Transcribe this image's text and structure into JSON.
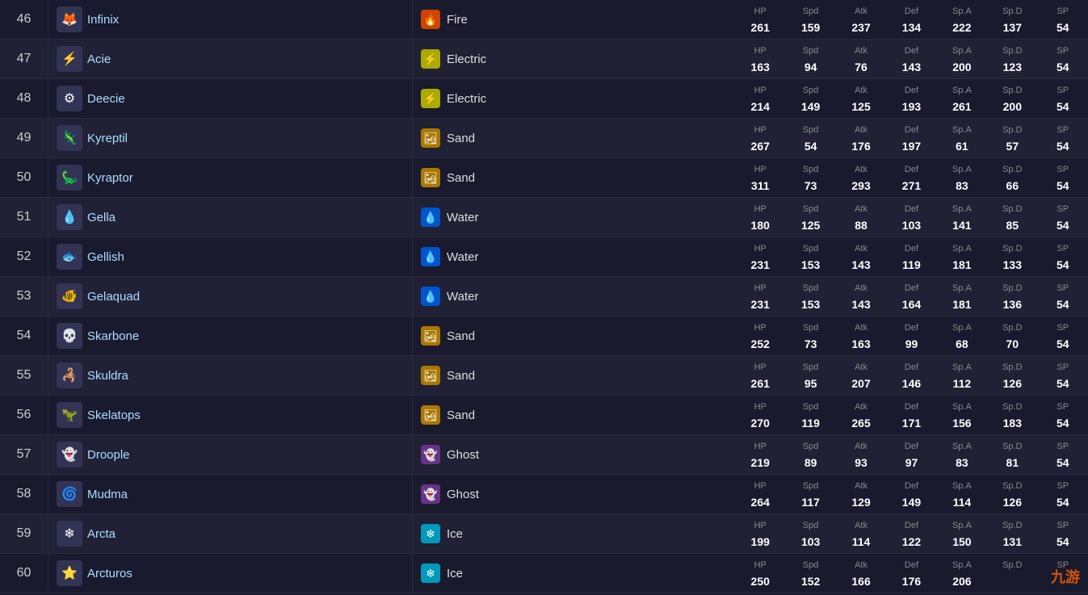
{
  "colors": {
    "accent": "#aaddff",
    "fire": "#cc4400",
    "electric": "#aaaa00",
    "sand": "#aa7700",
    "water": "#0055cc",
    "ghost": "#663388",
    "ice": "#0099bb"
  },
  "stat_labels": [
    "HP",
    "Spd",
    "Atk",
    "Def",
    "Sp.A",
    "Sp.D",
    "SP"
  ],
  "rows": [
    {
      "num": "46",
      "name": "Infinix",
      "icon": "🦊",
      "type": "Fire",
      "type_class": "type-fire",
      "type_icon": "🔥",
      "stats": [
        261,
        159,
        237,
        134,
        222,
        137,
        54
      ]
    },
    {
      "num": "47",
      "name": "Acie",
      "icon": "⚡",
      "type": "Electric",
      "type_class": "type-electric",
      "type_icon": "⚡",
      "stats": [
        163,
        94,
        76,
        143,
        200,
        123,
        54
      ]
    },
    {
      "num": "48",
      "name": "Deecie",
      "icon": "⚙",
      "type": "Electric",
      "type_class": "type-electric",
      "type_icon": "⚡",
      "stats": [
        214,
        149,
        125,
        193,
        261,
        200,
        54
      ]
    },
    {
      "num": "49",
      "name": "Kyreptil",
      "icon": "🦎",
      "type": "Sand",
      "type_class": "type-sand",
      "type_icon": "🏜",
      "stats": [
        267,
        54,
        176,
        197,
        61,
        57,
        54
      ]
    },
    {
      "num": "50",
      "name": "Kyraptor",
      "icon": "🦕",
      "type": "Sand",
      "type_class": "type-sand",
      "type_icon": "🏜",
      "stats": [
        311,
        73,
        293,
        271,
        83,
        66,
        54
      ]
    },
    {
      "num": "51",
      "name": "Gella",
      "icon": "💧",
      "type": "Water",
      "type_class": "type-water",
      "type_icon": "💧",
      "stats": [
        180,
        125,
        88,
        103,
        141,
        85,
        54
      ]
    },
    {
      "num": "52",
      "name": "Gellish",
      "icon": "🐟",
      "type": "Water",
      "type_class": "type-water",
      "type_icon": "💧",
      "stats": [
        231,
        153,
        143,
        119,
        181,
        133,
        54
      ]
    },
    {
      "num": "53",
      "name": "Gelaquad",
      "icon": "🐠",
      "type": "Water",
      "type_class": "type-water",
      "type_icon": "💧",
      "stats": [
        231,
        153,
        143,
        164,
        181,
        136,
        54
      ]
    },
    {
      "num": "54",
      "name": "Skarbone",
      "icon": "💀",
      "type": "Sand",
      "type_class": "type-sand",
      "type_icon": "🏜",
      "stats": [
        252,
        73,
        163,
        99,
        68,
        70,
        54
      ]
    },
    {
      "num": "55",
      "name": "Skuldra",
      "icon": "🦂",
      "type": "Sand",
      "type_class": "type-sand",
      "type_icon": "🏜",
      "stats": [
        261,
        95,
        207,
        146,
        112,
        126,
        54
      ]
    },
    {
      "num": "56",
      "name": "Skelatops",
      "icon": "🦖",
      "type": "Sand",
      "type_class": "type-sand",
      "type_icon": "🏜",
      "stats": [
        270,
        119,
        265,
        171,
        156,
        183,
        54
      ]
    },
    {
      "num": "57",
      "name": "Droople",
      "icon": "👻",
      "type": "Ghost",
      "type_class": "type-ghost",
      "type_icon": "👻",
      "stats": [
        219,
        89,
        93,
        97,
        83,
        81,
        54
      ]
    },
    {
      "num": "58",
      "name": "Mudma",
      "icon": "🌀",
      "type": "Ghost",
      "type_class": "type-ghost",
      "type_icon": "👻",
      "stats": [
        264,
        117,
        129,
        149,
        114,
        126,
        54
      ]
    },
    {
      "num": "59",
      "name": "Arcta",
      "icon": "❄",
      "type": "Ice",
      "type_class": "type-ice",
      "type_icon": "❄",
      "stats": [
        199,
        103,
        114,
        122,
        150,
        131,
        54
      ]
    },
    {
      "num": "60",
      "name": "Arcturos",
      "icon": "⭐",
      "type": "Ice",
      "type_class": "type-ice",
      "type_icon": "❄",
      "stats": [
        250,
        152,
        166,
        176,
        206,
        null,
        null
      ]
    }
  ],
  "watermark": "九游"
}
